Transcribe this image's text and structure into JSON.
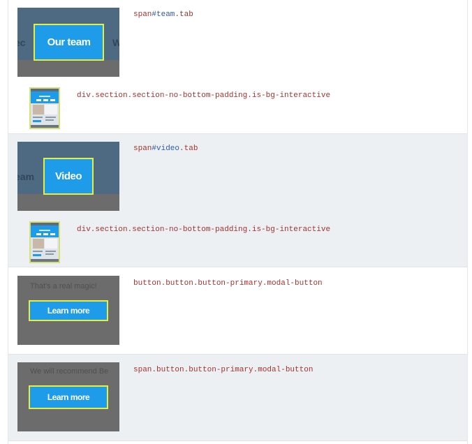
{
  "rows": [
    {
      "selector": {
        "tag": "span",
        "id": "#team",
        "rest": ".tab"
      },
      "thumb": {
        "label": "Our team",
        "ghost_left": "ec",
        "ghost_right": "W"
      }
    },
    {
      "selector": "div.section.section-no-bottom-padding.is-bg-interactive"
    },
    {
      "selector": {
        "tag": "span",
        "id": "#video",
        "rest": ".tab"
      },
      "thumb": {
        "label": "Video",
        "ghost_left": "eam"
      }
    },
    {
      "selector": "div.section.section-no-bottom-padding.is-bg-interactive"
    },
    {
      "selector": "button.button.button-primary.modal-button",
      "thumb": {
        "label": "Learn more",
        "context_text": "That's a real magic!"
      }
    },
    {
      "selector": "span.button.button-primary.modal-button",
      "thumb": {
        "label": "Learn more",
        "context_text": "We will recommend Be"
      }
    }
  ]
}
